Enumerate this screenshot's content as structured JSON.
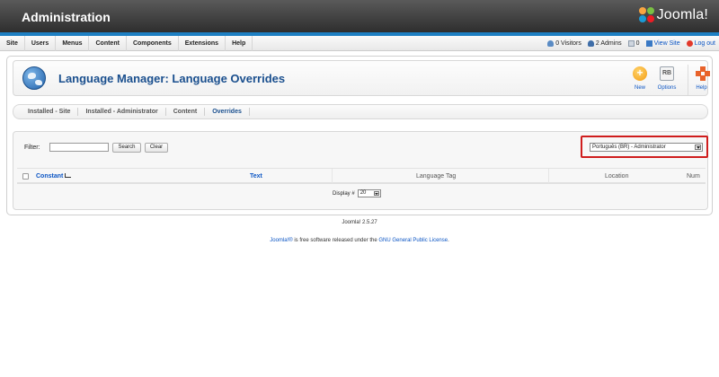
{
  "app": {
    "title": "Administration",
    "brand": "Joomla!"
  },
  "menu": [
    "Site",
    "Users",
    "Menus",
    "Content",
    "Components",
    "Extensions",
    "Help"
  ],
  "status": {
    "visitors": "0 Visitors",
    "admins": "2 Admins",
    "messages": "0",
    "view_site": "View Site",
    "logout": "Log out"
  },
  "header": {
    "title": "Language Manager: Language Overrides"
  },
  "toolbar": {
    "new": "New",
    "options": "Options",
    "options_glyph": "RB",
    "help": "Help"
  },
  "subnav": [
    "Installed - Site",
    "Installed - Administrator",
    "Content",
    "Overrides"
  ],
  "filter": {
    "label": "Filter:",
    "value": "",
    "search": "Search",
    "clear": "Clear"
  },
  "language_select": {
    "selected": "Português (BR) - Administrator"
  },
  "table": {
    "columns": [
      "Constant",
      "Text",
      "Language Tag",
      "Location",
      "Num"
    ]
  },
  "pager": {
    "label": "Display #",
    "value": "20"
  },
  "footer": {
    "version": "Joomla! 2.5.27",
    "license_brand": "Joomla!®",
    "license_text": " is free software released under the ",
    "license_link": "GNU General Public License",
    "license_end": "."
  },
  "colors": {
    "accent": "#1d7fc2",
    "link": "#0b55c4",
    "highlight": "#cf1d1d"
  }
}
